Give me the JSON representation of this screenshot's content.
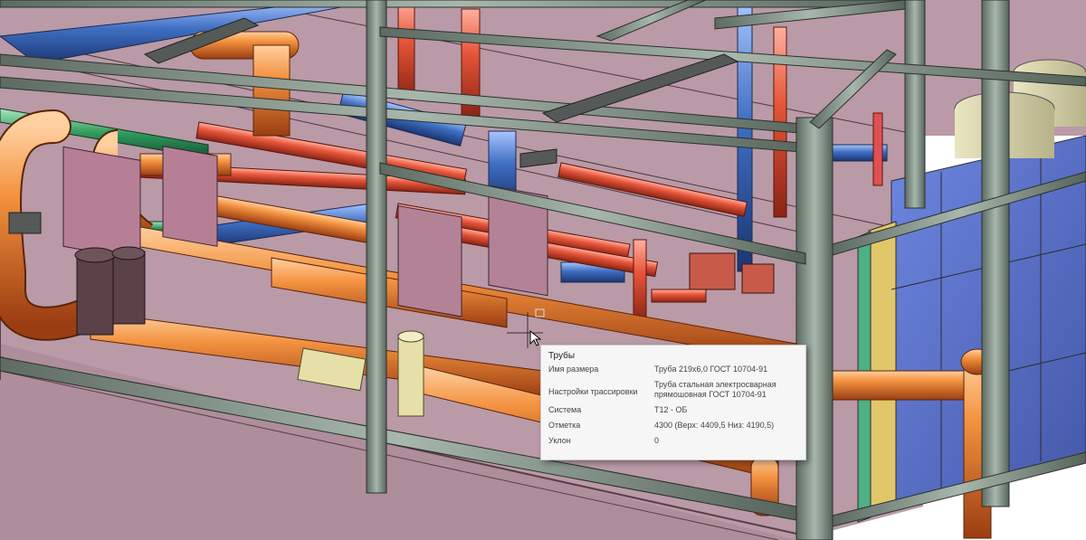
{
  "tooltip": {
    "title": "Трубы",
    "rows": [
      {
        "key": "Имя размера",
        "value": "Труба 219х6,0 ГОСТ 10704-91"
      },
      {
        "key": "Настройки трассировки",
        "value": "Труба стальная электросварная прямошовная ГОСТ 10704-91"
      },
      {
        "key": "Система",
        "value": "Т12 - ОБ"
      },
      {
        "key": "Отметка",
        "value": "4300 (Верх: 4409,5 Низ: 4190,5)"
      },
      {
        "key": "Уклон",
        "value": "0"
      }
    ]
  },
  "colors": {
    "floor": "#b99aa6",
    "steel": "#8f9d92",
    "hot_pipe": "#f07a2e",
    "return_pipe": "#e4553a",
    "cold_pipe": "#3f6fc2",
    "green_pipe": "#2f9a5c",
    "panel": "#5b72c8"
  },
  "icons": [
    "cursor-crosshair-icon"
  ]
}
